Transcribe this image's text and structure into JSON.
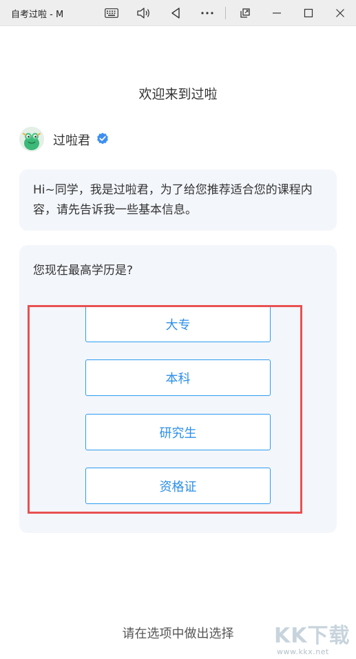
{
  "window": {
    "title": "自考过啦 - M",
    "icons": [
      "keyboard-icon",
      "volume-icon",
      "back-icon",
      "more-icon",
      "restore-icon",
      "minimize-icon",
      "maximize-icon",
      "close-icon"
    ]
  },
  "page": {
    "heading": "欢迎来到过啦"
  },
  "bot": {
    "name": "过啦君",
    "verified_icon": "verified-badge-icon"
  },
  "messages": {
    "greeting": "Hi~同学，我是过啦君，为了给您推荐适合您的课程内容，请先告诉我一些基本信息。"
  },
  "question": {
    "text": "您现在最高学历是?",
    "options": [
      "大专",
      "本科",
      "研究生",
      "资格证"
    ]
  },
  "footer": {
    "hint": "请在选项中做出选择"
  },
  "watermark": {
    "main": "KK下载",
    "url": "www.kkx.net"
  },
  "colors": {
    "accent": "#2b9bf0",
    "highlight": "#e85050",
    "card_bg": "#f3f6fb"
  }
}
